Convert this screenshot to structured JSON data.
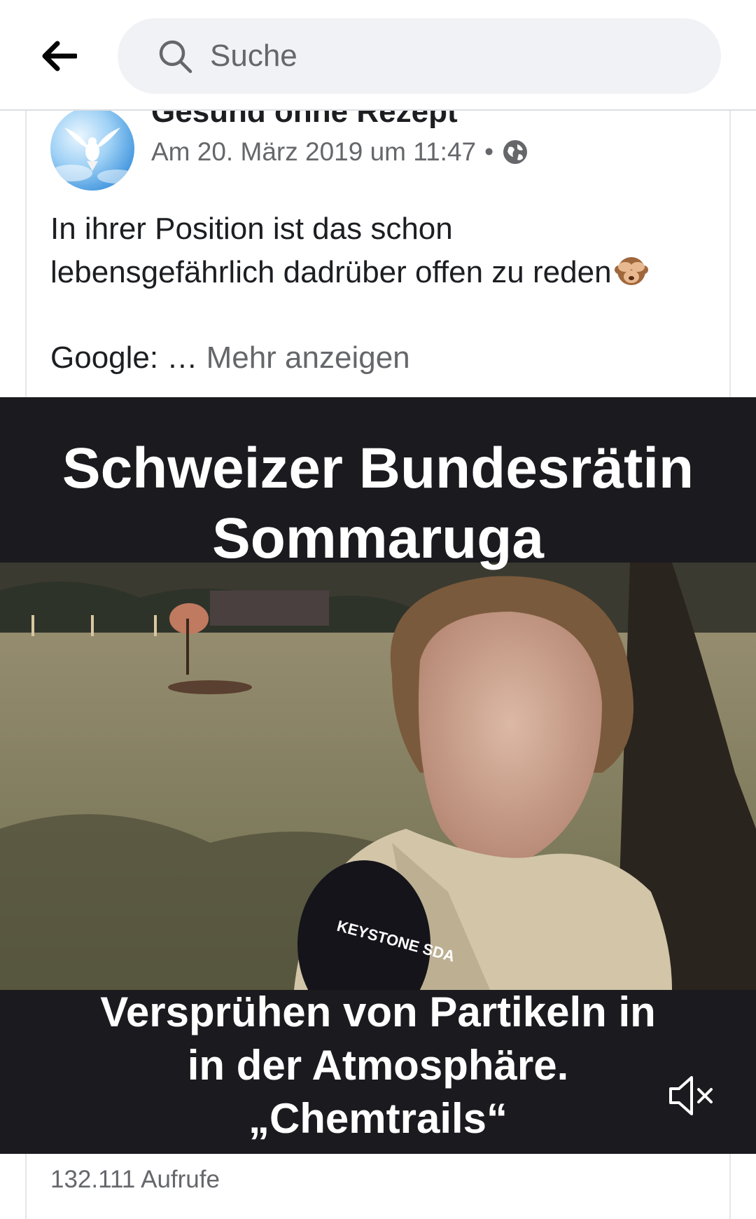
{
  "search": {
    "placeholder": "Suche"
  },
  "post": {
    "page_name": "Gesund ohne Rezept",
    "date": "Am 20. März 2019 um 11:47",
    "separator": "•",
    "text_line1": "In ihrer Position ist das schon",
    "text_line2": "lebensgefährlich dadrüber offen zu reden",
    "text_google": "Google: …",
    "more_label": "Mehr anzeigen"
  },
  "video": {
    "caption_top_line1": "Schweizer Bundesrätin",
    "caption_top_line2": "Sommaruga",
    "caption_bottom_line1": "Versprühen von Partikeln in",
    "caption_bottom_line2": "in der Atmosphäre.",
    "caption_bottom_line3": "„Chemtrails“",
    "mic_label": "KEYSTONE SDA"
  },
  "views": "132.111 Aufrufe",
  "icons": {
    "back": "back-arrow-icon",
    "search": "search-icon",
    "privacy": "globe-icon",
    "mute": "speaker-muted-icon",
    "emoji": "see-no-evil-monkey-emoji"
  }
}
